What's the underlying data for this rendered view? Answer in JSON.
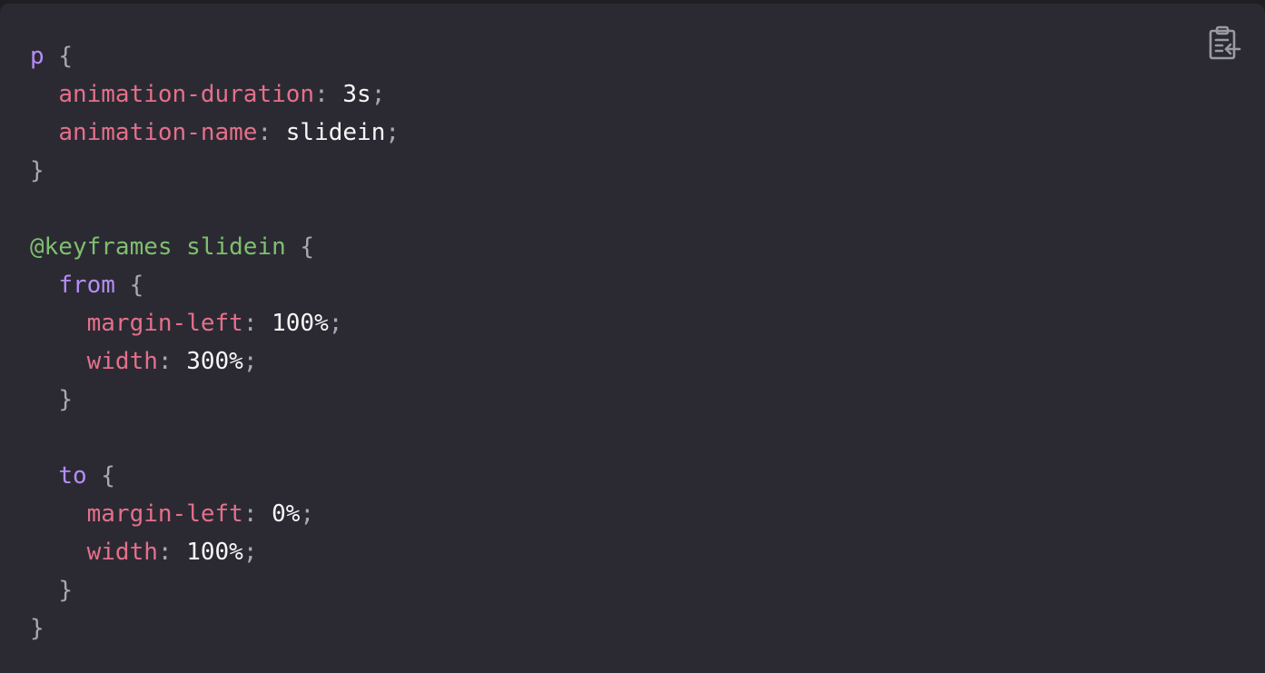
{
  "copy_button": {
    "icon": "clipboard-copy-icon",
    "color": "#9a9aa2"
  },
  "colors": {
    "background": "#2b2a33",
    "selector": "#b48ef5",
    "property": "#e4708a",
    "value": "#f7f7f7",
    "at_rule": "#7fbf6f",
    "punctuation": "#a8a8b0"
  },
  "code": {
    "l1": {
      "selector": "p",
      "brace": "{"
    },
    "l2": {
      "prop": "animation-duration",
      "colon": ":",
      "value": "3s",
      "semi": ";"
    },
    "l3": {
      "prop": "animation-name",
      "colon": ":",
      "value": "slidein",
      "semi": ";"
    },
    "l4": {
      "brace": "}"
    },
    "l6": {
      "at_rule": "@keyframes slidein",
      "brace": "{"
    },
    "l7": {
      "selector": "from",
      "brace": "{"
    },
    "l8": {
      "prop": "margin-left",
      "colon": ":",
      "value": "100%",
      "semi": ";"
    },
    "l9": {
      "prop": "width",
      "colon": ":",
      "value": "300%",
      "semi": ";"
    },
    "l10": {
      "brace": "}"
    },
    "l12": {
      "selector": "to",
      "brace": "{"
    },
    "l13": {
      "prop": "margin-left",
      "colon": ":",
      "value": "0%",
      "semi": ";"
    },
    "l14": {
      "prop": "width",
      "colon": ":",
      "value": "100%",
      "semi": ";"
    },
    "l15": {
      "brace": "}"
    },
    "l16": {
      "brace": "}"
    }
  }
}
